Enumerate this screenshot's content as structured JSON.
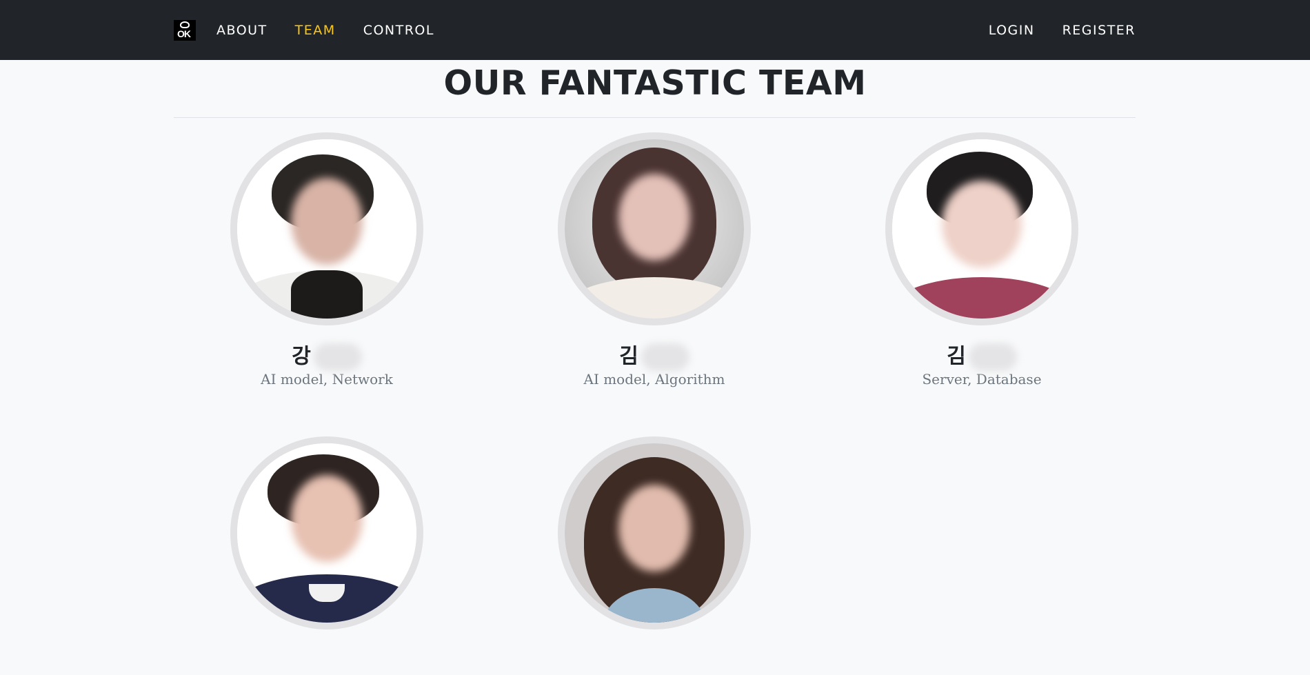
{
  "nav": {
    "logo_text": "OK",
    "links_left": [
      "ABOUT",
      "TEAM",
      "CONTROL"
    ],
    "links_right": [
      "LOGIN",
      "REGISTER"
    ],
    "active": "TEAM"
  },
  "colors": {
    "navbar": "#212529",
    "active_link": "#fec810",
    "page_bg": "#f8f9fa",
    "role_text": "#6c757d",
    "avatar_ring": "#e2e2e4"
  },
  "title": "OUR FANTASTIC TEAM",
  "members": [
    {
      "name": "강",
      "role": "AI model, Network",
      "photo": "photo-blurred-face"
    },
    {
      "name": "김",
      "role": "AI model, Algorithm",
      "photo": "photo-blurred-face"
    },
    {
      "name": "김",
      "role": "Server, Database",
      "photo": "photo-blurred-face"
    },
    {
      "name": "",
      "role": "",
      "photo": "photo-blurred-face"
    },
    {
      "name": "",
      "role": "",
      "photo": "photo-blurred-face"
    }
  ]
}
